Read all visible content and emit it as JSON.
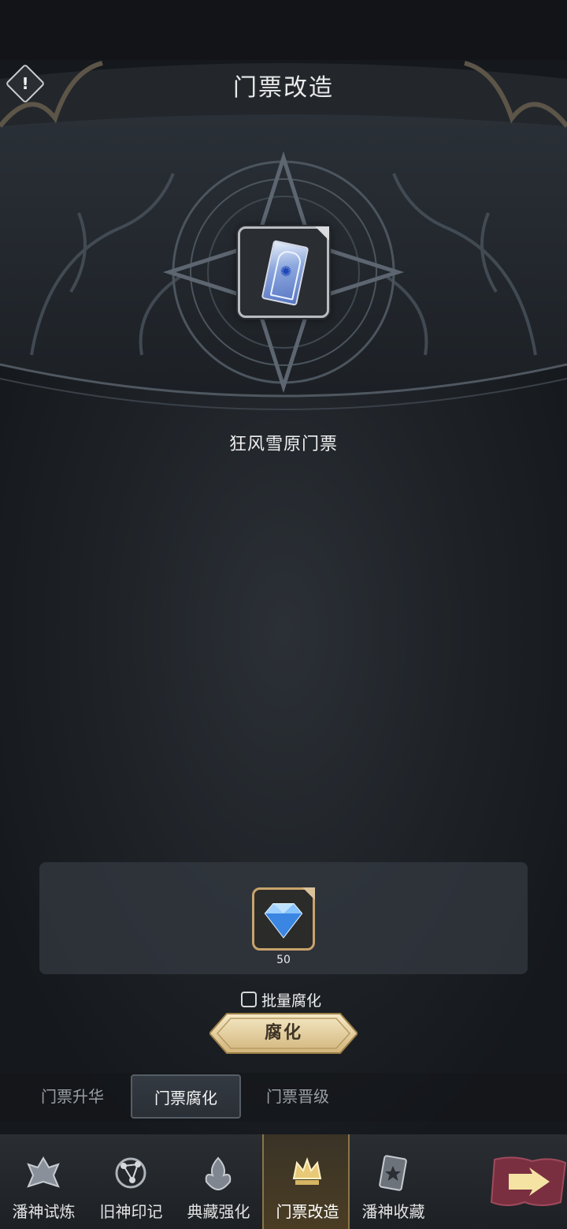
{
  "header": {
    "title": "门票改造",
    "warn_icon_glyph": "!"
  },
  "item": {
    "name": "狂风雪原门票",
    "icon": "ticket-icon"
  },
  "cost": {
    "icon": "diamond-icon",
    "amount": "50"
  },
  "batch": {
    "label": "批量腐化",
    "checked": false
  },
  "action": {
    "label": "腐化"
  },
  "sub_tabs": [
    {
      "label": "门票升华",
      "active": false
    },
    {
      "label": "门票腐化",
      "active": true
    },
    {
      "label": "门票晋级",
      "active": false
    }
  ],
  "nav": [
    {
      "label": "潘神试炼",
      "icon": "trial-emblem-icon",
      "active": false
    },
    {
      "label": "旧神印记",
      "icon": "constellation-icon",
      "active": false
    },
    {
      "label": "典藏强化",
      "icon": "flame-emblem-icon",
      "active": false
    },
    {
      "label": "门票改造",
      "icon": "crown-emblem-icon",
      "active": true
    },
    {
      "label": "潘神收藏",
      "icon": "star-card-icon",
      "active": false
    }
  ],
  "colors": {
    "accent_gold": "#d8c08c",
    "panel": "#343a42",
    "background": "#15181c"
  }
}
